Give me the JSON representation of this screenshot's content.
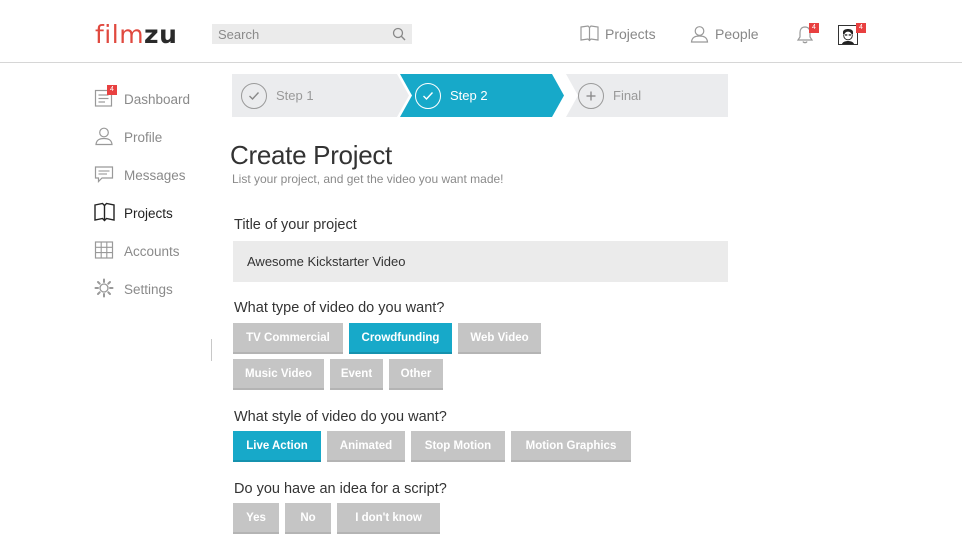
{
  "header": {
    "logo_part1": "film",
    "logo_part2": "zu",
    "search_placeholder": "Search",
    "nav_projects": "Projects",
    "nav_people": "People",
    "notifications_badge": "4",
    "avatar_badge": "4"
  },
  "sidebar": {
    "items": [
      {
        "label": "Dashboard",
        "icon": "dashboard-icon",
        "badge": "4"
      },
      {
        "label": "Profile",
        "icon": "user-icon"
      },
      {
        "label": "Messages",
        "icon": "message-icon"
      },
      {
        "label": "Projects",
        "icon": "book-icon",
        "active": true
      },
      {
        "label": "Accounts",
        "icon": "grid-icon"
      },
      {
        "label": "Settings",
        "icon": "gear-icon"
      }
    ]
  },
  "steps": [
    {
      "label": "Step 1",
      "state": "done"
    },
    {
      "label": "Step 2",
      "state": "current"
    },
    {
      "label": "Final",
      "state": "pending"
    }
  ],
  "form": {
    "title": "Create Project",
    "subtitle": "List your project, and get the video you want made!",
    "project_title_label": "Title of your project",
    "project_title_value": "Awesome Kickstarter Video",
    "video_type_label": "What type of video do you want?",
    "video_types": [
      "TV Commercial",
      "Crowdfunding",
      "Web Video",
      "Music Video",
      "Event",
      "Other"
    ],
    "video_type_selected": "Crowdfunding",
    "video_style_label": "What style of video do you want?",
    "video_styles": [
      "Live Action",
      "Animated",
      "Stop Motion",
      "Motion Graphics"
    ],
    "video_style_selected": "Live Action",
    "script_label": "Do you have an idea for a script?",
    "script_options": [
      "Yes",
      "No",
      "I don't know"
    ]
  },
  "colors": {
    "accent": "#17a9c9",
    "brand_red": "#e0493f",
    "badge_red": "#e84040",
    "button_gray": "#c5c5c5",
    "step_gray": "#ebecee"
  }
}
